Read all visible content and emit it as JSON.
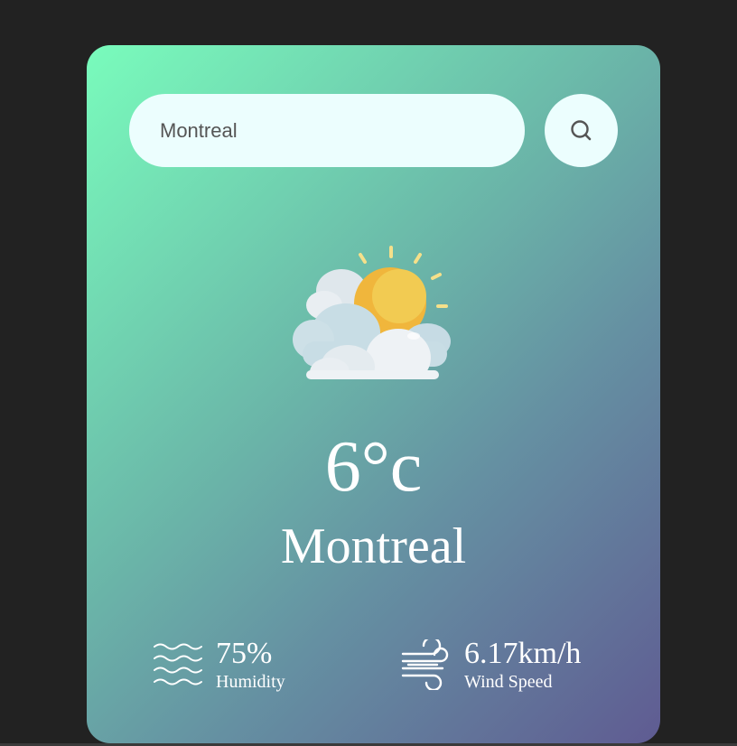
{
  "search": {
    "value": "Montreal",
    "button_icon": "search-icon"
  },
  "weather": {
    "icon": "partly-cloudy-sun-icon",
    "temperature": "6°c",
    "city": "Montreal"
  },
  "details": {
    "humidity": {
      "icon": "humidity-waves-icon",
      "value": "75%",
      "label": "Humidity"
    },
    "wind": {
      "icon": "wind-icon",
      "value": "6.17km/h",
      "label": "Wind Speed"
    }
  },
  "colors": {
    "page_background": "#222222",
    "gradient_start": "#79fcbc",
    "gradient_end": "#5f5b92",
    "input_background": "#ecfefe",
    "sun": "#f0b63c"
  }
}
